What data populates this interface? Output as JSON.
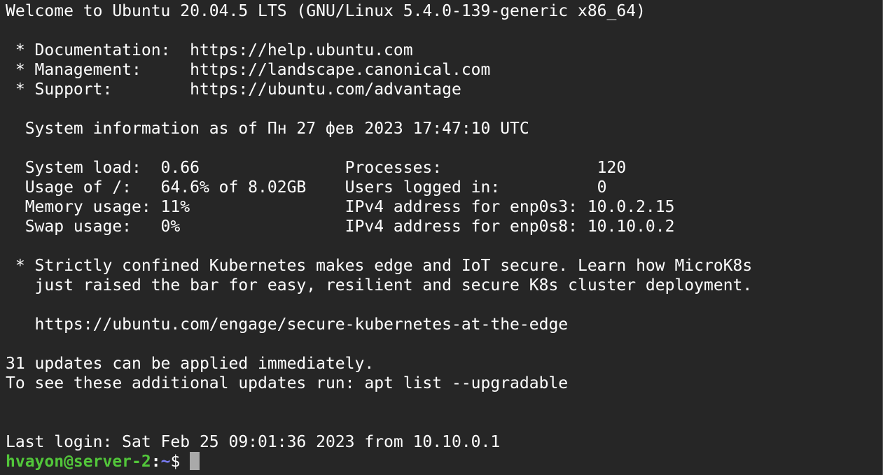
{
  "terminal": {
    "lines": {
      "welcome": "Welcome to Ubuntu 20.04.5 LTS (GNU/Linux 5.4.0-139-generic x86_64)",
      "blank1": "",
      "doc": " * Documentation:  https://help.ubuntu.com",
      "mgmt": " * Management:     https://landscape.canonical.com",
      "support": " * Support:        https://ubuntu.com/advantage",
      "blank2": "",
      "sysinfo": "  System information as of Пн 27 фев 2023 17:47:10 UTC",
      "blank3": "",
      "stat1": "  System load:  0.66               Processes:                120",
      "stat2": "  Usage of /:   64.6% of 8.02GB    Users logged in:          0",
      "stat3": "  Memory usage: 11%                IPv4 address for enp0s3: 10.0.2.15",
      "stat4": "  Swap usage:   0%                 IPv4 address for enp0s8: 10.10.0.2",
      "blank4": "",
      "news1": " * Strictly confined Kubernetes makes edge and IoT secure. Learn how MicroK8s",
      "news2": "   just raised the bar for easy, resilient and secure K8s cluster deployment.",
      "blank5": "",
      "news_url": "   https://ubuntu.com/engage/secure-kubernetes-at-the-edge",
      "blank6": "",
      "updates1": "31 updates can be applied immediately.",
      "updates2": "To see these additional updates run: apt list --upgradable",
      "blank7": "",
      "blank8": "",
      "last_login": "Last login: Sat Feb 25 09:01:36 2023 from 10.10.0.1"
    },
    "prompt": {
      "user_host": "hvayon@server-2",
      "separator": ":",
      "path": "~",
      "symbol": "$"
    },
    "colors": {
      "background": "#262626",
      "text": "#ffffff",
      "prompt_user": "#52c63a",
      "prompt_path": "#7a7cf5",
      "cursor": "#a9a9a9"
    }
  }
}
